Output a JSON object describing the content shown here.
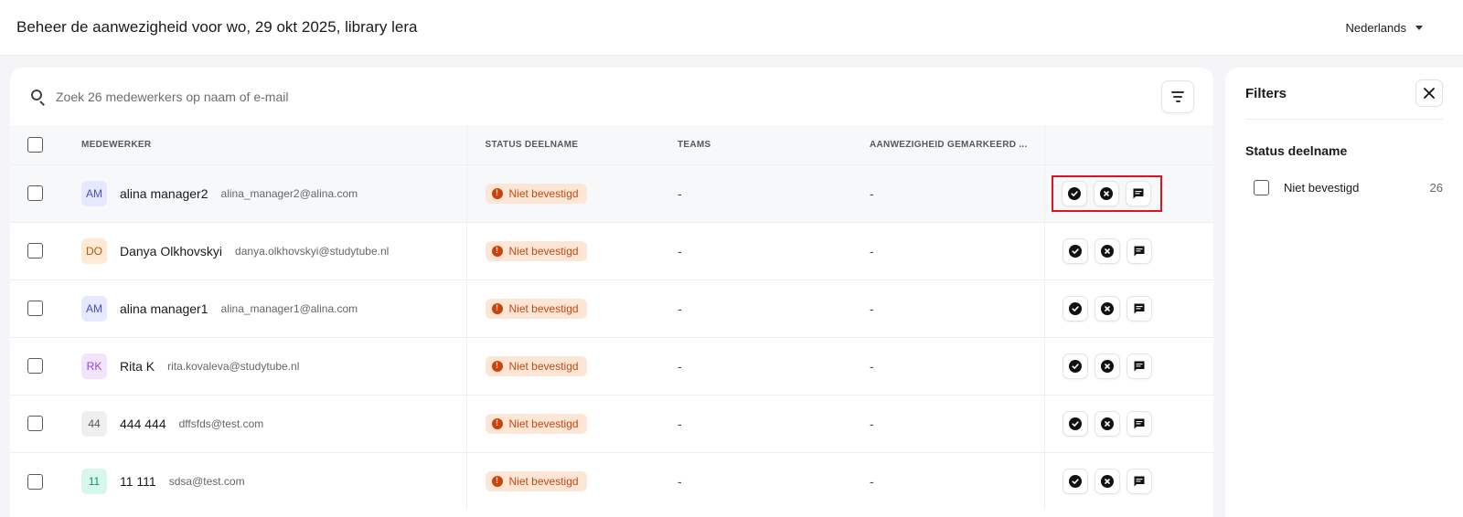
{
  "page": {
    "title": "Beheer de aanwezigheid voor wo, 29 okt 2025, library lera",
    "language": "Nederlands"
  },
  "search": {
    "placeholder": "Zoek 26 medewerkers op naam of e-mail"
  },
  "table": {
    "columns": {
      "employee": "MEDEWERKER",
      "status": "STATUS DEELNAME",
      "teams": "TEAMS",
      "marked": "AANWEZIGHEID GEMARKEERD ..."
    },
    "rows": [
      {
        "initials": "AM",
        "name": "alina manager2",
        "email": "alina_manager2@alina.com",
        "status": "Niet bevestigd",
        "teams": "-",
        "marked": "-"
      },
      {
        "initials": "DO",
        "name": "Danya Olkhovskyi",
        "email": "danya.olkhovskyi@studytube.nl",
        "status": "Niet bevestigd",
        "teams": "-",
        "marked": "-"
      },
      {
        "initials": "AM",
        "name": "alina manager1",
        "email": "alina_manager1@alina.com",
        "status": "Niet bevestigd",
        "teams": "-",
        "marked": "-"
      },
      {
        "initials": "RK",
        "name": "Rita K",
        "email": "rita.kovaleva@studytube.nl",
        "status": "Niet bevestigd",
        "teams": "-",
        "marked": "-"
      },
      {
        "initials": "44",
        "name": "444 444",
        "email": "dffsfds@test.com",
        "status": "Niet bevestigd",
        "teams": "-",
        "marked": "-"
      },
      {
        "initials": "11",
        "name": "11 111",
        "email": "sdsa@test.com",
        "status": "Niet bevestigd",
        "teams": "-",
        "marked": "-"
      }
    ],
    "row_actions": [
      "check-circle-icon",
      "x-circle-icon",
      "message-icon"
    ]
  },
  "avatar_colors": {
    "AM": {
      "bg": "#e6e8ff",
      "fg": "#4a4fc4"
    },
    "DO": {
      "bg": "#fde9d4",
      "fg": "#c2570e"
    },
    "RK": {
      "bg": "#f1e4fb",
      "fg": "#9b3fd1"
    },
    "44": {
      "bg": "#efefef",
      "fg": "#555555"
    },
    "11": {
      "bg": "#d7f6ec",
      "fg": "#13946b"
    }
  },
  "filters": {
    "title": "Filters",
    "section": "Status deelname",
    "options": [
      {
        "label": "Niet bevestigd",
        "count": "26"
      }
    ]
  },
  "colors": {
    "status_badge_bg": "#fde6d6",
    "status_badge_fg": "#c24a12",
    "highlight": "#e0131e"
  }
}
